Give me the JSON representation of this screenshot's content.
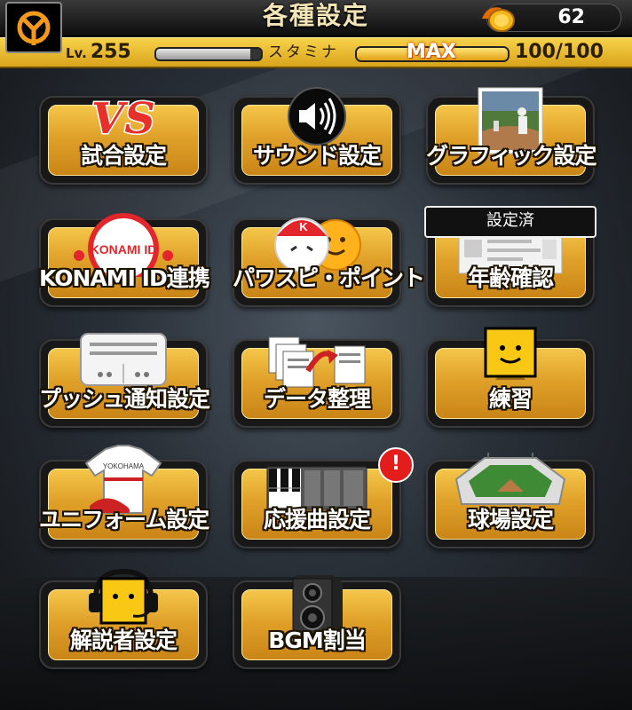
{
  "header": {
    "title": "各種設定",
    "coin_count": "62",
    "level_prefix": "Lv.",
    "level": "255",
    "stamina_label": "スタミナ",
    "stamina_max_label": "MAX",
    "stamina_value": "100/100",
    "exp_progress": 0.9,
    "stamina_progress": 1.0
  },
  "menu": {
    "match_settings": "試合設定",
    "sound_settings": "サウンド設定",
    "graphic_settings": "グラフィック設定",
    "konami_id_link": "KONAMI ID連携",
    "konami_id_logo": "KONAMI ID",
    "pawaspi_point": "パワスピ・ポイント",
    "age_confirm": "年齢確認",
    "age_confirm_status": "設定済",
    "push_settings": "プッシュ通知設定",
    "data_management": "データ整理",
    "practice": "練習",
    "uniform_settings": "ユニフォーム設定",
    "cheer_song_settings": "応援曲設定",
    "stadium_settings": "球場設定",
    "commentator_settings": "解説者設定",
    "bgm_assign": "BGM割当",
    "vs_logo": "VS",
    "alert_mark": "!"
  },
  "icons": [
    "team-logo-icon",
    "coin-icon",
    "vs-icon",
    "speaker-icon",
    "baseball-photo-icon",
    "konami-id-icon",
    "pawapuro-face-icon",
    "id-card-icon",
    "push-device-icon",
    "data-documents-icon",
    "smiley-block-icon",
    "uniform-icon",
    "piano-keys-icon",
    "stadium-icon",
    "headset-character-icon",
    "speaker-box-icon"
  ],
  "colors": {
    "accent": "#e0a12a",
    "status_bar": "#f7d24a",
    "alert": "#e31c1c"
  }
}
